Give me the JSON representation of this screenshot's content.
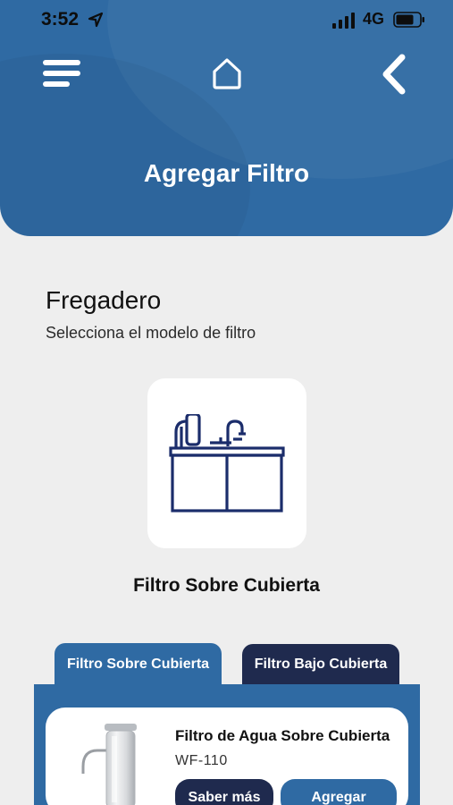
{
  "status_bar": {
    "time": "3:52",
    "network": "4G",
    "icons": [
      "location-arrow-icon",
      "signal-icon",
      "battery-icon"
    ]
  },
  "header": {
    "title": "Agregar Filtro",
    "icons": [
      "menu-icon",
      "home-icon",
      "back-chevron-icon"
    ]
  },
  "section": {
    "title": "Fregadero",
    "subtitle": "Selecciona el modelo de filtro"
  },
  "filter_option": {
    "caption": "Filtro Sobre Cubierta",
    "icon": "sink-filter-icon"
  },
  "tabs": [
    {
      "label": "Filtro Sobre Cubierta",
      "active": true
    },
    {
      "label": "Filtro Bajo Cubierta",
      "active": false
    }
  ],
  "product": {
    "name": "Filtro de Agua Sobre Cubierta",
    "model": "WF-110",
    "buttons": {
      "more_label": "Saber más",
      "add_label": "Agregar"
    }
  },
  "colors": {
    "primary_blue": "#2f6aa3",
    "navy": "#1f2a4e",
    "background": "#eeeeee",
    "icon_navy": "#1b2d6b"
  }
}
